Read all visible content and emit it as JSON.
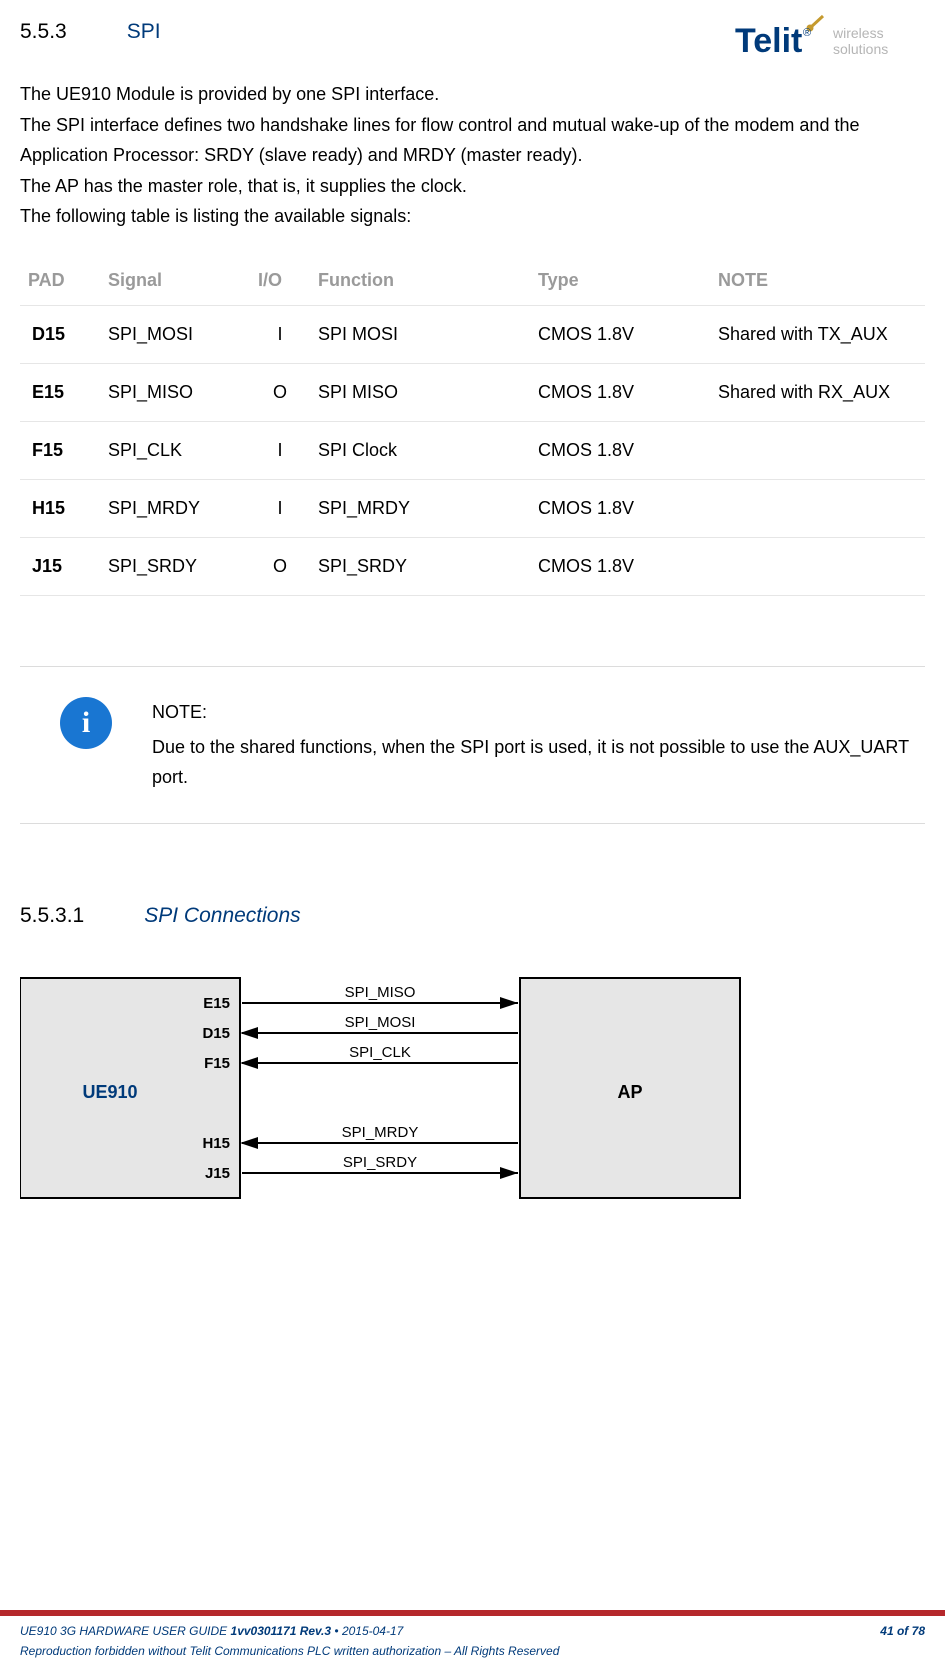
{
  "header": {
    "section_number": "5.5.3",
    "section_title": "SPI",
    "logo_brand": "Telit",
    "logo_sub1": "wireless",
    "logo_sub2": "solutions"
  },
  "body": {
    "p1": "The UE910 Module is provided by one SPI interface.",
    "p2": "The SPI interface defines two handshake lines for flow control and mutual wake-up of the modem and the Application Processor: SRDY (slave ready) and MRDY (master ready).",
    "p3": "The AP has the master role, that is, it supplies the clock.",
    "p4": "The following table is listing the available signals:"
  },
  "table": {
    "headers": {
      "pad": "PAD",
      "signal": "Signal",
      "io": "I/O",
      "function": "Function",
      "type": "Type",
      "note": "NOTE"
    },
    "rows": [
      {
        "pad": "D15",
        "signal": "SPI_MOSI",
        "io": "I",
        "function": "SPI MOSI",
        "type": "CMOS 1.8V",
        "note": "Shared with TX_AUX"
      },
      {
        "pad": "E15",
        "signal": "SPI_MISO",
        "io": "O",
        "function": "SPI MISO",
        "type": "CMOS 1.8V",
        "note": "Shared with RX_AUX"
      },
      {
        "pad": "F15",
        "signal": "SPI_CLK",
        "io": "I",
        "function": "SPI Clock",
        "type": "CMOS 1.8V",
        "note": ""
      },
      {
        "pad": "H15",
        "signal": "SPI_MRDY",
        "io": "I",
        "function": "SPI_MRDY",
        "type": "CMOS 1.8V",
        "note": ""
      },
      {
        "pad": "J15",
        "signal": "SPI_SRDY",
        "io": "O",
        "function": "SPI_SRDY",
        "type": "CMOS 1.8V",
        "note": ""
      }
    ]
  },
  "note": {
    "label": "NOTE:",
    "text": "Due to the shared functions, when the SPI port is used, it is not possible to use the AUX_UART port."
  },
  "subsection": {
    "number": "5.5.3.1",
    "title": "SPI Connections"
  },
  "diagram": {
    "left_box": "UE910",
    "right_box": "AP",
    "pins": [
      "E15",
      "D15",
      "F15",
      "H15",
      "J15"
    ],
    "signals": [
      "SPI_MISO",
      "SPI_MOSI",
      "SPI_CLK",
      "SPI_MRDY",
      "SPI_SRDY"
    ]
  },
  "footer": {
    "doc": "UE910 3G HARDWARE USER GUIDE",
    "rev": "1vv0301171 Rev.3",
    "sep": " • ",
    "date": "2015-04-17",
    "page": "41 of 78",
    "legal": "Reproduction forbidden without Telit Communications PLC written authorization – All Rights Reserved"
  }
}
